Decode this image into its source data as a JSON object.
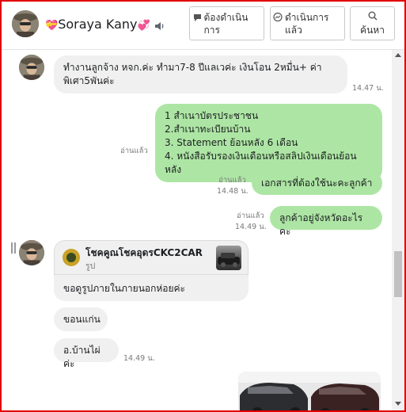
{
  "header": {
    "name": "Soraya Kany",
    "emoji_left": "💝",
    "emoji_right": "💞",
    "btn_todo": "ต้องดำเนินการ",
    "btn_done": "ดำเนินการแล้ว",
    "btn_search": "ค้นหา"
  },
  "messages": {
    "m1": {
      "line1": "ทำงานลูกจ้าง หจก.ค่ะ ทำมา7-8 ปีแลเวค่ะ เงินโอน 2หมื่น+ ค่า",
      "line2": "พิเศา5พันค่ะ",
      "time": "14.47 น."
    },
    "m2": {
      "line1": "1 สำเนาบัตรประชาชน",
      "line2": "2.สำเนาทะเบียนบ้าน",
      "line3": " 3. Statement ย้อนหลัง 6 เดือน",
      "line4": "4. หนังสือรับรองเงินเดือนหรือสลิปเงินเดือนย้อนหลัง",
      "read": "อ่านแล้ว"
    },
    "m3": {
      "text": "เอกสารที่ต้องใช้นะคะลูกค้า",
      "read": "อ่านแล้ว",
      "time": "14.48 น."
    },
    "m4": {
      "text": "ลูกค้าอยู่จังหวัดอะไรคะ",
      "read": "อ่านแล้ว",
      "time": "14.49 น."
    },
    "shared": {
      "title": "โชคคูณโชคอุดรCKC2CAR",
      "sub": "รูป",
      "caption": "ขอดูรูปภายในภายนอกห่อยค่ะ"
    },
    "m6": {
      "text": "ขอนแก่น"
    },
    "m7": {
      "text": "อ.บ้านไผ่ค่ะ",
      "time": "14.49 น."
    }
  },
  "colors": {
    "frame": "#e00000",
    "outgoing": "#ade6a4",
    "incoming": "#f0f0f0"
  },
  "icons": {
    "speaker": "speaker-icon",
    "todo": "chat-bubble-icon",
    "done": "messenger-icon",
    "search": "search-icon"
  }
}
